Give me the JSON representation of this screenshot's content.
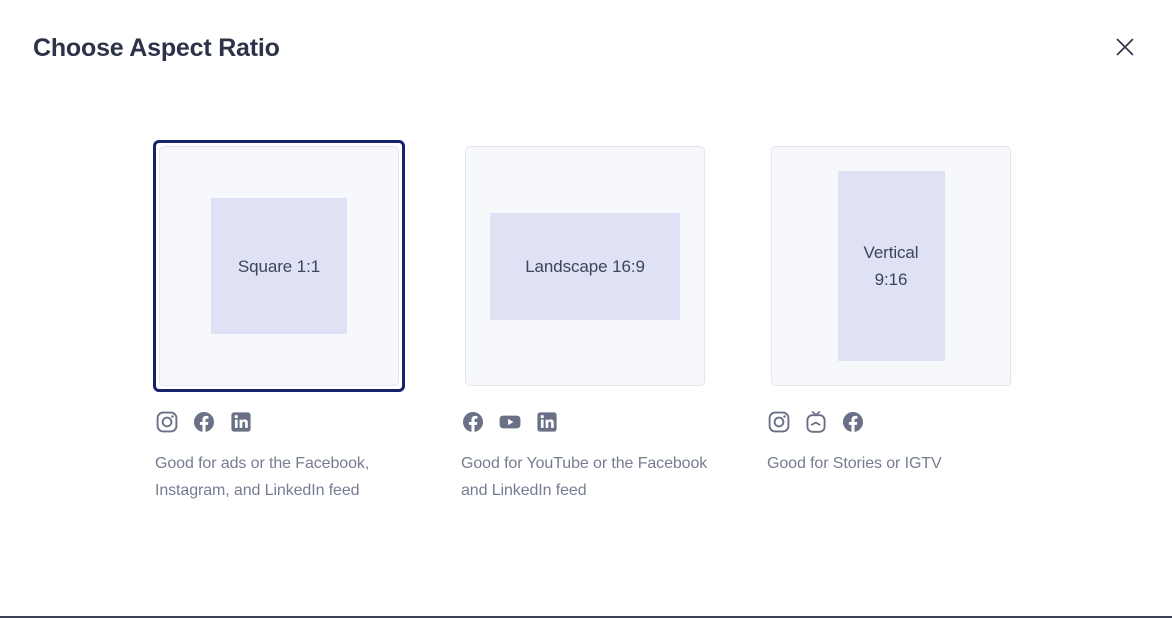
{
  "header": {
    "title": "Choose Aspect Ratio",
    "close_icon": "close-icon"
  },
  "colors": {
    "selected_border": "#17226b",
    "card_background": "#f6f8fc",
    "preview_fill": "#dee2f4",
    "title_text": "#2c3348",
    "caption_text": "#767d92",
    "icon": "#6a7186"
  },
  "options": [
    {
      "id": "square",
      "label": "Square 1:1",
      "selected": true,
      "social_icons": [
        "instagram-icon",
        "facebook-icon",
        "linkedin-icon"
      ],
      "caption": "Good for ads or the Facebook, Instagram, and LinkedIn feed"
    },
    {
      "id": "landscape",
      "label": "Landscape 16:9",
      "selected": false,
      "social_icons": [
        "facebook-icon",
        "youtube-icon",
        "linkedin-icon"
      ],
      "caption": "Good for YouTube or the Facebook and LinkedIn feed"
    },
    {
      "id": "vertical",
      "label_line1": "Vertical",
      "label_line2": "9:16",
      "selected": false,
      "social_icons": [
        "instagram-icon",
        "igtv-icon",
        "facebook-icon"
      ],
      "caption": "Good for Stories or IGTV"
    }
  ]
}
